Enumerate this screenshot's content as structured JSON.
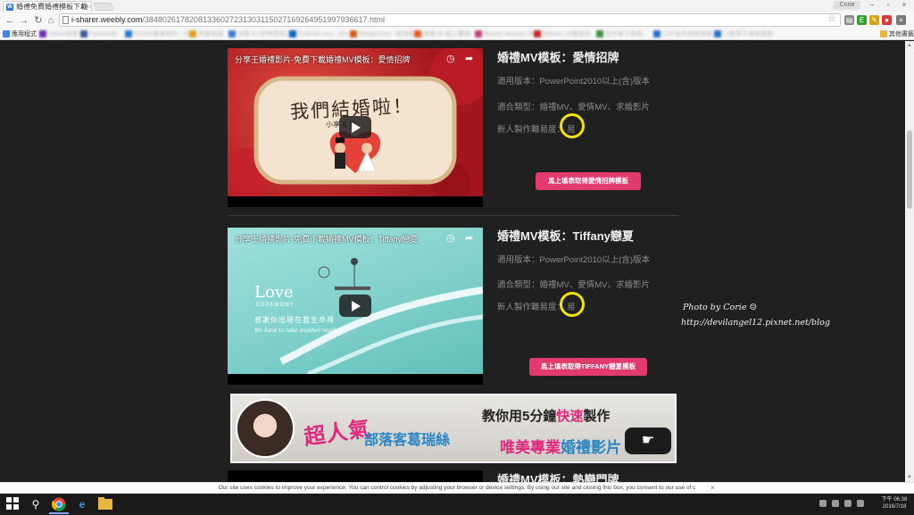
{
  "browser": {
    "tab_title": "婚禮免費婚禮模板下載 -",
    "tab_favicon_letter": "W",
    "user_label": "Corie",
    "url_host": "i-sharer.weebly.com",
    "url_path": "/38480261782081336027231303115027169264951997936617.html",
    "bookmarks": [
      {
        "label": "應用程式",
        "color": "#4285f4"
      },
      {
        "label": "Yahoo奇摩",
        "color": "#6b2fb3"
      },
      {
        "label": "Facebook",
        "color": "#3b5998"
      },
      {
        "label": "COWA專業條件 - 中..",
        "color": "#2b7bd2"
      },
      {
        "label": "早瓣建議",
        "color": "#e0a020"
      },
      {
        "label": "谷歌 h-i 好時雲知之",
        "color": "#3d7bd6"
      },
      {
        "label": "Outlook.com - dev...",
        "color": "#0a64c8"
      },
      {
        "label": "Bloggerdes - 部落格",
        "color": "#d45e1a"
      },
      {
        "label": "美國 IG 線上賽單",
        "color": "#ee5a24"
      },
      {
        "label": "Beauty Awards 2015",
        "color": "#c43f7c"
      },
      {
        "label": "Nielsen 主機版本",
        "color": "#cc2a2a"
      },
      {
        "label": "在外貿下易部",
        "color": "#3f8d46"
      },
      {
        "label": "口平金外旗航部部..",
        "color": "#2a6fcf"
      },
      {
        "label": "口貿易下易收據部",
        "color": "#2a6fcf"
      },
      {
        "label": "其他書籤",
        "color": "#e7b93a"
      }
    ]
  },
  "products": [
    {
      "video_title": "分享王婚禮影片-免費下載婚禮MV模板：愛情招牌",
      "title": "婚禮MV模板：愛情招牌",
      "version_line": "適用版本：PowerPoint2010以上(含)版本",
      "type_line": "適合類型：婚禮MV、愛情MV、求婚影片",
      "difficulty_label": "新人製作難易度：",
      "difficulty_value": "易",
      "cta": "馬上填表取得愛情招牌模板",
      "frame_text_main": "我們結婚啦！",
      "frame_text_names": "小享 & 芬"
    },
    {
      "video_title": "分享王婚禮影片-免費下載婚禮MV模板：Tiffany戀夏",
      "title": "婚禮MV模板：Tiffany戀夏",
      "version_line": "適用版本：PowerPoint2010以上(含)版本",
      "type_line": "適合類型：婚禮MV、愛情MV、求婚影片",
      "difficulty_label": "新人製作難易度：",
      "difficulty_value": "易",
      "cta": "馬上填表取得TIFFANY戀夏模板",
      "frame_text_love": "Love",
      "frame_text_ceremony": "CEREMONY",
      "frame_text_cn": "感謝你出現在我生命裡",
      "frame_text_script": "We have to take another ready"
    }
  ],
  "watermark": {
    "line1": "Photo by Corie ☺",
    "line2": "http://devilangel12.pixnet.net/blog"
  },
  "banner": {
    "t1": "超人氣",
    "t2": "部落客葛瑞絲",
    "t3_a": "教你用5分鐘",
    "t3_hl": "快速",
    "t3_b": "製作",
    "t4_hl": "唯美專業",
    "t4_b": "婚禮影片"
  },
  "next_product_title": "婚禮MV模板：熱戀門牌",
  "cookie_text": "Our site uses cookies to improve your experience. You can control cookies by adjusting your browser or device settings. By using our site and closing this box, you consent to our use of c",
  "taskbar": {
    "clock_time": "下午 06:38",
    "clock_date": "2016/7/18"
  },
  "colors": {
    "page_bg": "#202020",
    "cta_pink": "#e23a6c",
    "highlight_yellow": "#f5e400"
  }
}
